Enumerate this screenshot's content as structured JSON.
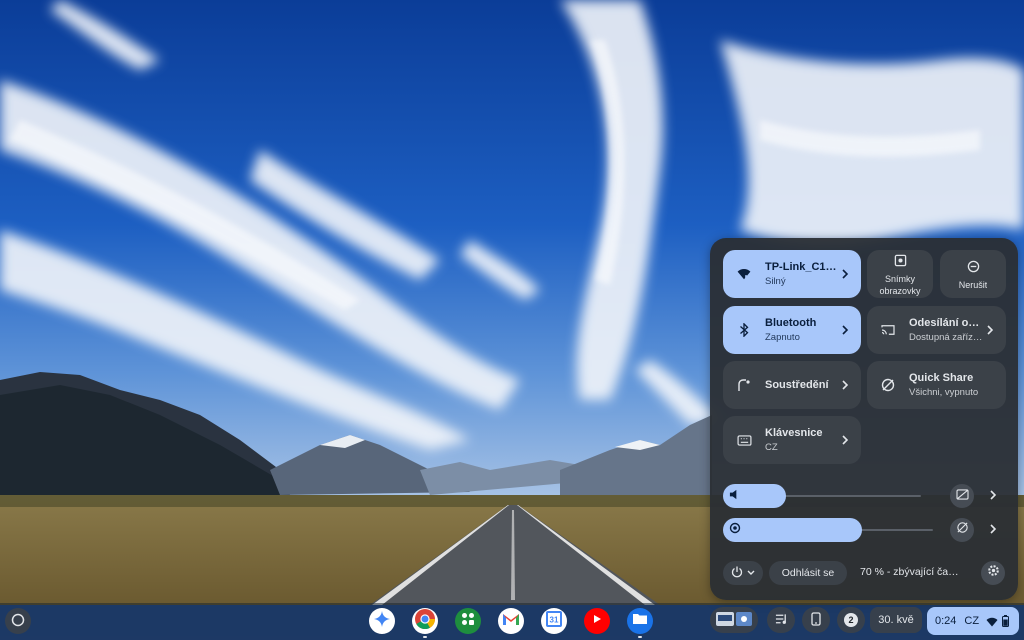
{
  "quick_settings": {
    "network": {
      "title": "TP-Link_C154…",
      "subtitle": "Silný",
      "icon": "wifi-icon"
    },
    "screenshot": {
      "label": "Snímky obrazovky",
      "icon": "screen-capture-icon"
    },
    "dnd": {
      "label": "Nerušit",
      "icon": "do-not-disturb-icon"
    },
    "bluetooth": {
      "title": "Bluetooth",
      "subtitle": "Zapnuto",
      "icon": "bluetooth-icon"
    },
    "cast": {
      "title": "Odesílání obr…",
      "subtitle": "Dostupná zařízení",
      "icon": "cast-icon"
    },
    "focus": {
      "title": "Soustředění",
      "icon": "focus-mode-icon"
    },
    "quick_share": {
      "title": "Quick Share",
      "subtitle": "Všichni, vypnuto",
      "icon": "quick-share-icon"
    },
    "keyboard": {
      "title": "Klávesnice",
      "subtitle": "CZ",
      "icon": "keyboard-icon"
    },
    "volume": {
      "icon": "volume-icon",
      "level": 0.32
    },
    "brightness": {
      "icon": "brightness-icon",
      "level": 0.66
    },
    "sign_out_label": "Odhlásit se",
    "battery_text": "70 % - zbývající ča…"
  },
  "shelf": {
    "notification_count": "2",
    "date": "30. kvě",
    "time": "0:24",
    "ime": "CZ",
    "accent": "#a8c7fa",
    "apps": [
      "gemini-icon",
      "chrome-icon",
      "app-launcher-icon",
      "gmail-icon",
      "calendar-icon",
      "youtube-icon",
      "files-icon"
    ]
  }
}
